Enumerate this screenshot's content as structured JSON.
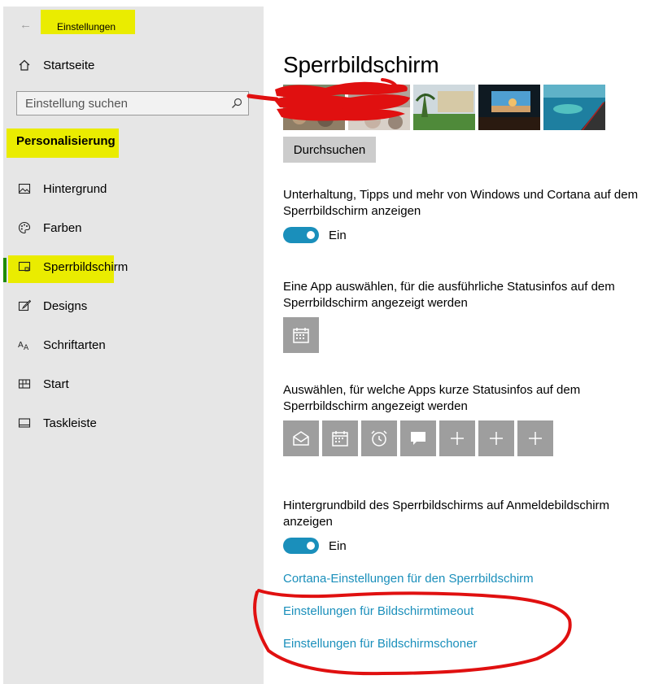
{
  "sidebar": {
    "app_title": "Einstellungen",
    "home_label": "Startseite",
    "search_placeholder": "Einstellung suchen",
    "section_heading": "Personalisierung",
    "items": [
      {
        "label": "Hintergrund",
        "icon": "image-icon"
      },
      {
        "label": "Farben",
        "icon": "palette-icon"
      },
      {
        "label": "Sperrbildschirm",
        "icon": "lock-screen-icon",
        "active": true
      },
      {
        "label": "Designs",
        "icon": "brush-icon"
      },
      {
        "label": "Schriftarten",
        "icon": "font-icon"
      },
      {
        "label": "Start",
        "icon": "start-icon"
      },
      {
        "label": "Taskleiste",
        "icon": "taskbar-icon"
      }
    ]
  },
  "main": {
    "title": "Sperrbildschirm",
    "browse_button": "Durchsuchen",
    "tips_text": "Unterhaltung, Tipps und mehr von Windows und Cortana auf dem Sperrbildschirm anzeigen",
    "tips_toggle": "Ein",
    "detailed_status_text": "Eine App auswählen, für die ausführliche Statusinfos auf dem Sperrbildschirm angezeigt werden",
    "quick_status_text": "Auswählen, für welche Apps kurze Statusinfos auf dem Sperrbildschirm angezeigt werden",
    "quick_status_apps": [
      "mail-icon",
      "calendar-icon",
      "alarm-clock-icon",
      "chat-icon",
      "plus-icon",
      "plus-icon",
      "plus-icon"
    ],
    "signin_bg_text": "Hintergrundbild des Sperrbildschirms auf Anmeldebildschirm anzeigen",
    "signin_toggle": "Ein",
    "links": {
      "cortana": "Cortana-Einstellungen für den Sperrbildschirm",
      "timeout": "Einstellungen für Bildschirmtimeout",
      "screensaver": "Einstellungen für Bildschirmschoner"
    }
  },
  "colors": {
    "accent": "#1a8fbb",
    "highlight": "#eaec00",
    "annotation": "#e01010",
    "sidebar_bg": "#e6e6e6"
  }
}
